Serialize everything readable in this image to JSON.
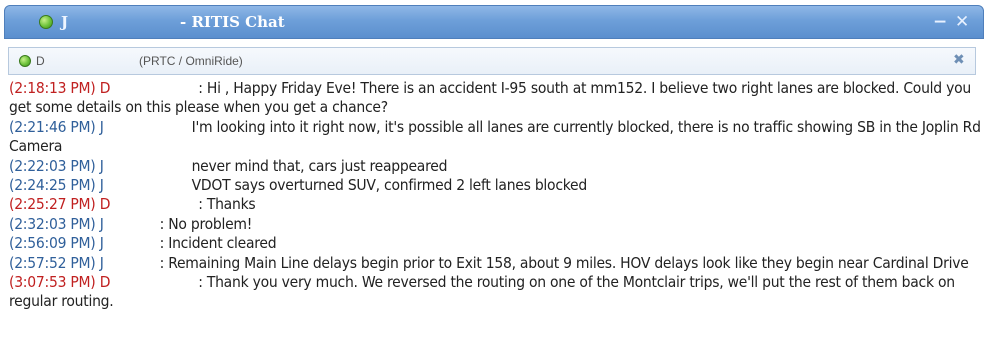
{
  "window": {
    "title_user": "J",
    "title": "- RITIS Chat",
    "minimize_symbol": "−",
    "close_symbol": "✕"
  },
  "tab": {
    "user": "D",
    "org": "(PRTC / OmniRide)",
    "close_symbol": "✖"
  },
  "colors": {
    "remote_timestamp": "#c02020",
    "local_timestamp": "#2f5f9a",
    "title_bar": "#6d9fd9",
    "status_online": "#6cc23a"
  },
  "messages": [
    {
      "time": "(2:18:13 PM)",
      "sender": "D",
      "text": ": Hi        , Happy Friday Eve! There is an accident I-95 south at mm152. I believe two right lanes are blocked. Could you get some details on this please when you get a chance?"
    },
    {
      "time": "(2:21:46 PM)",
      "sender": "J",
      "text": "I'm looking into it right now, it's possible all lanes are currently blocked, there is no traffic showing SB in the Joplin Rd Camera"
    },
    {
      "time": "(2:22:03 PM)",
      "sender": "J",
      "text": "never mind that, cars just reappeared"
    },
    {
      "time": "(2:24:25 PM)",
      "sender": "J",
      "text": "VDOT says overturned SUV, confirmed 2 left lanes blocked"
    },
    {
      "time": "(2:25:27 PM)",
      "sender": "D",
      "text": ": Thanks"
    },
    {
      "time": "(2:32:03 PM)",
      "sender": "J",
      "text": ": No problem!"
    },
    {
      "time": "(2:56:09 PM)",
      "sender": "J",
      "text": ": Incident cleared"
    },
    {
      "time": "(2:57:52 PM)",
      "sender": "J",
      "text": ": Remaining Main Line delays begin prior to Exit 158, about 9 miles. HOV delays look like they begin near Cardinal Drive"
    },
    {
      "time": "(3:07:53 PM)",
      "sender": "D",
      "text": ": Thank you very much. We reversed the routing on one of the Montclair trips, we'll put the rest of them back on regular routing."
    }
  ]
}
